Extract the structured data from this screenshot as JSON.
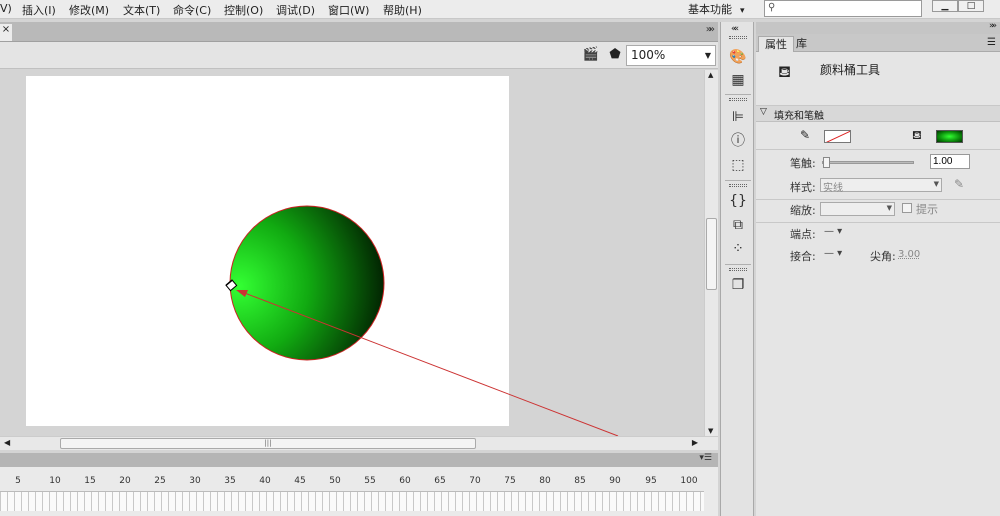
{
  "menubar": {
    "items": [
      "V)",
      "插入(I)",
      "修改(M)",
      "文本(T)",
      "命令(C)",
      "控制(O)",
      "调试(D)",
      "窗口(W)",
      "帮助(H)"
    ],
    "workspace": "基本功能",
    "search_placeholder": ""
  },
  "document": {
    "tab_close": "×",
    "zoom": "100%"
  },
  "timeline": {
    "ruler_ticks": [
      "5",
      "10",
      "15",
      "20",
      "25",
      "30",
      "35",
      "40",
      "45",
      "50",
      "55",
      "60",
      "65",
      "70",
      "75",
      "80",
      "85",
      "90",
      "95",
      "100"
    ]
  },
  "panel": {
    "tabs": [
      "属性",
      "库"
    ],
    "tool_name": "颜料桶工具",
    "section_title": "填充和笔触",
    "stroke_label": "笔触:",
    "stroke_value": "1.00",
    "style_label": "样式:",
    "style_value": "实线",
    "scale_label": "缩放:",
    "hint_label": "提示",
    "cap_label": "端点:",
    "join_label": "接合:",
    "miter_label": "尖角:",
    "miter_value": "3.00"
  },
  "colors": {
    "stage_bg": "#ffffff",
    "fill_center": "#33ff33",
    "fill_edge": "#001a00",
    "stroke_color": "#cc2222",
    "arrow_color": "#cc3333"
  },
  "icons": [
    "camera-icon",
    "pen-icon",
    "palette-icon",
    "grid-icon",
    "align-icon",
    "info-icon",
    "transform-icon",
    "code-icon",
    "components-icon",
    "motion-icon",
    "layers-icon",
    "paint-bucket-icon",
    "pencil-icon",
    "search-icon"
  ]
}
